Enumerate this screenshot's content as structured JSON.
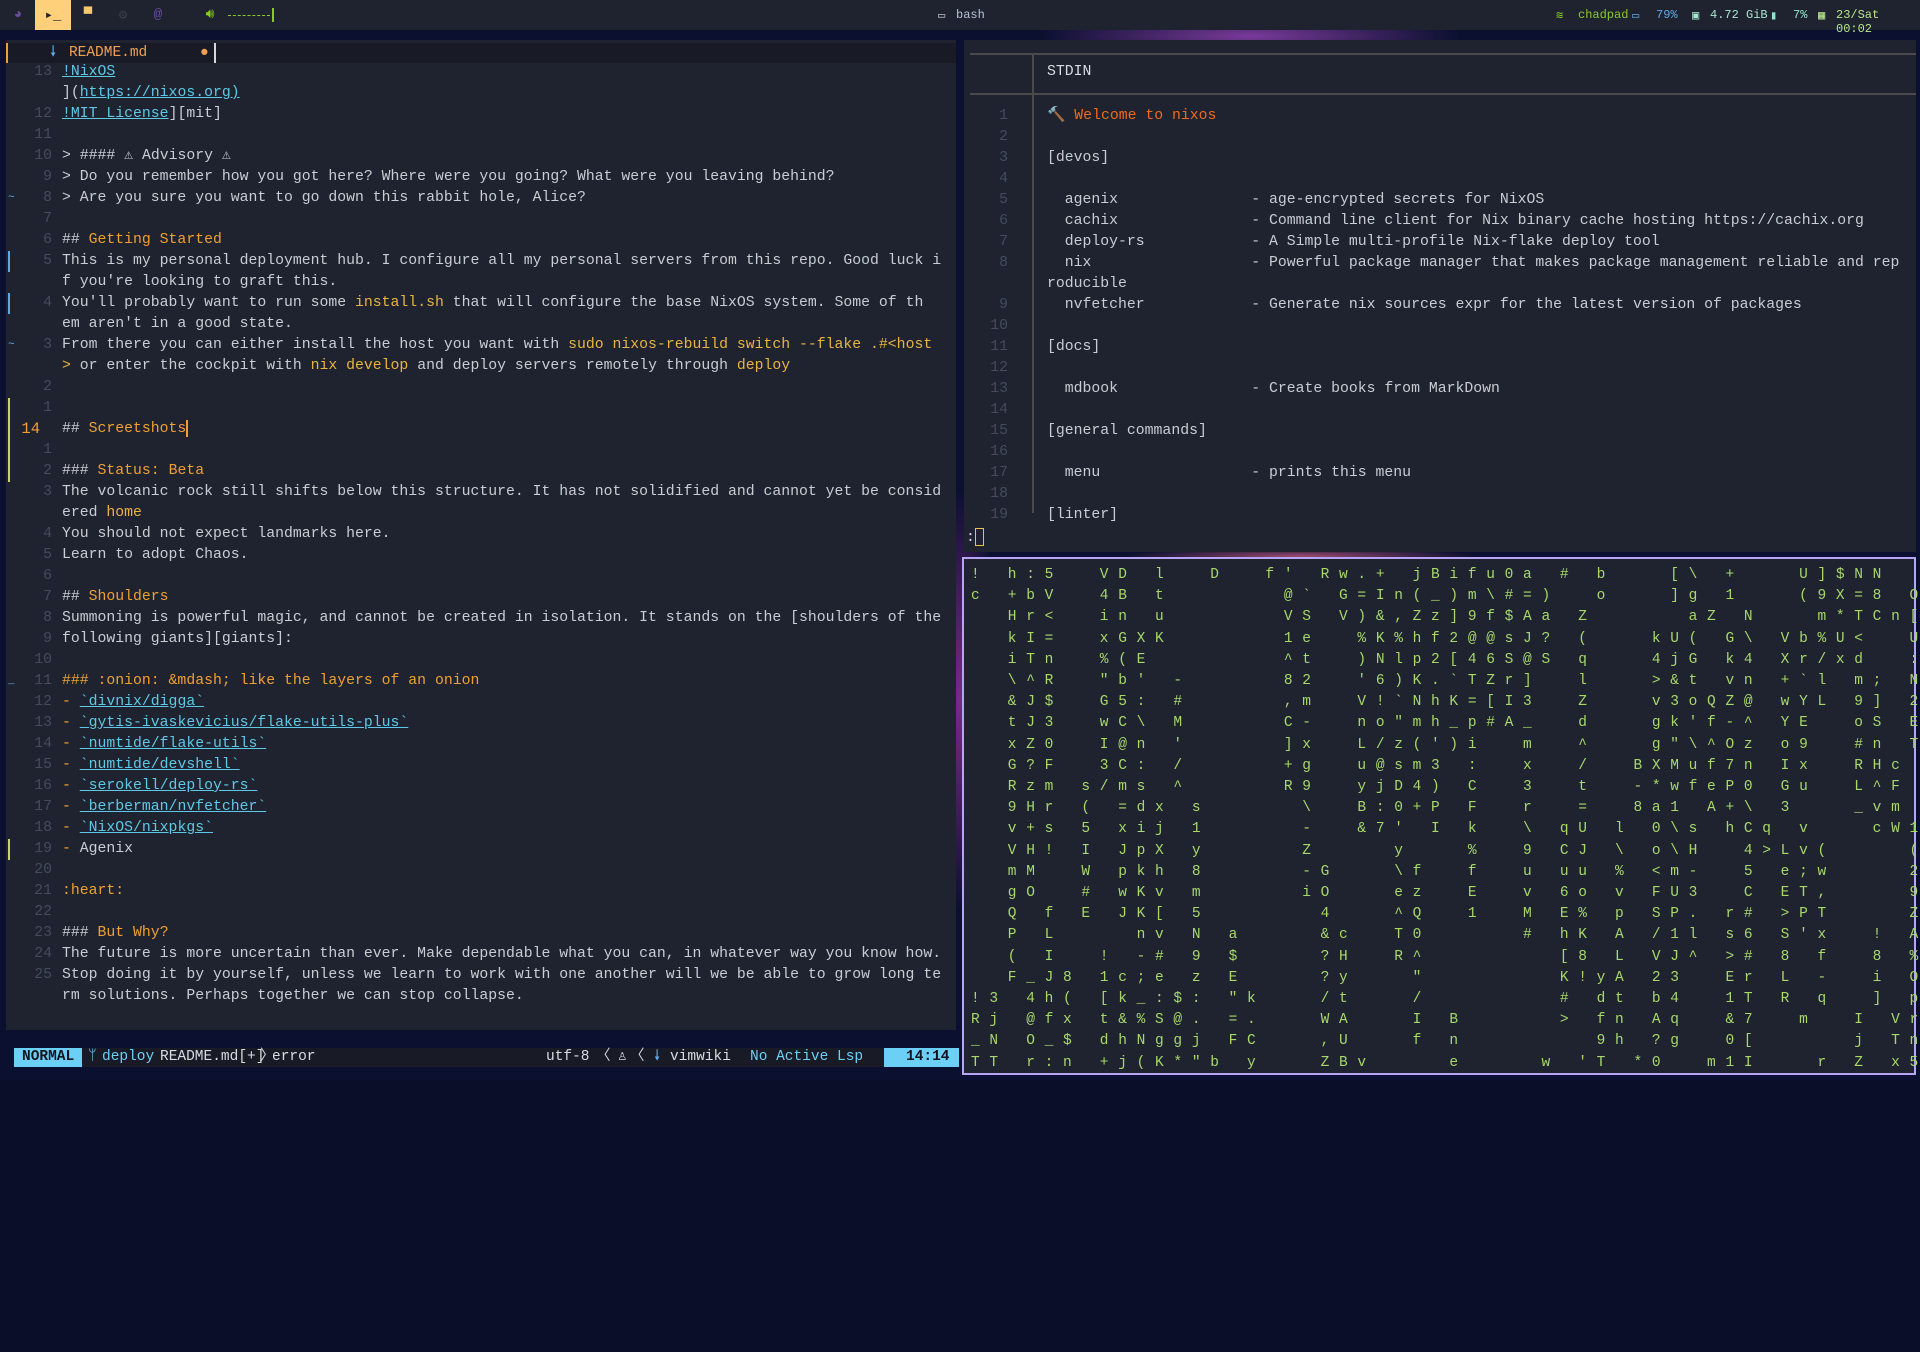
{
  "topbar": {
    "workspaces": [
      {
        "icon": "firefox-icon",
        "glyph": "◕",
        "color": "#6a4c9c"
      },
      {
        "icon": "terminal-icon",
        "glyph": "▸_",
        "color": "#1f2330",
        "active": true
      },
      {
        "icon": "chat-icon",
        "glyph": "▀",
        "color": "#f5c86a"
      },
      {
        "icon": "gear-icon",
        "glyph": "⚙",
        "color": "#3a3f4c"
      },
      {
        "icon": "at-icon",
        "glyph": "@",
        "color": "#6a4c9c"
      }
    ],
    "volume_level": 1.0,
    "window_title": "bash",
    "wifi": "chadpad",
    "battery": "79%",
    "memory": "4.72 GiB",
    "cpu": "7%",
    "datetime": "23/Sat 00:02",
    "colors": {
      "green": "#8ac926",
      "blue": "#5fa8e6",
      "active": "#ffd07a"
    }
  },
  "editor": {
    "tab": {
      "filename": "README.md",
      "modified": "●"
    },
    "lines": [
      {
        "n": "13",
        "s": [
          [
            "!NixOS",
            "link"
          ]
        ]
      },
      {
        "n": "",
        "s": [
          [
            "](",
            "t"
          ],
          [
            "https://nixos.org)",
            "link"
          ]
        ]
      },
      {
        "n": "12",
        "s": [
          [
            "!MIT License",
            "link"
          ],
          [
            "][mit]",
            "t"
          ]
        ]
      },
      {
        "n": "11",
        "s": []
      },
      {
        "n": "10",
        "s": [
          [
            "> #### ⚠ Advisory ⚠",
            "t"
          ]
        ]
      },
      {
        "n": "9",
        "s": [
          [
            "> Do you remember how you got here? Where were you going? What were you leaving behind?",
            "t"
          ]
        ]
      },
      {
        "n": "8",
        "sign": "~",
        "s": [
          [
            "> Are you sure you want to go down this rabbit hole, Alice?",
            "t"
          ]
        ]
      },
      {
        "n": "7",
        "s": []
      },
      {
        "n": "6",
        "s": [
          [
            "## ",
            "t"
          ],
          [
            "Getting Started",
            "h"
          ]
        ]
      },
      {
        "n": "5",
        "bar": "#5fa8e6",
        "s": [
          [
            "This is my personal deployment hub. I configure all my personal servers from this repo. Good luck i",
            "t"
          ]
        ]
      },
      {
        "n": "",
        "s": [
          [
            "f you're looking to graft this.",
            "t"
          ]
        ]
      },
      {
        "n": "4",
        "bar": "#5fa8e6",
        "s": [
          [
            "You'll probably want to run some ",
            "t"
          ],
          [
            "install.sh",
            "code"
          ],
          [
            " that will configure the base NixOS system. Some of th",
            "t"
          ]
        ]
      },
      {
        "n": "",
        "s": [
          [
            "em aren't in a good state.",
            "t"
          ]
        ]
      },
      {
        "n": "3",
        "sign": "~",
        "s": [
          [
            "From there you can either install the host you want with ",
            "t"
          ],
          [
            "sudo nixos-rebuild switch --flake .#<host",
            "code"
          ]
        ]
      },
      {
        "n": "",
        "s": [
          [
            "> ",
            "code"
          ],
          [
            "or enter the cockpit with ",
            "t"
          ],
          [
            "nix develop",
            "code"
          ],
          [
            " and deploy servers remotely through ",
            "t"
          ],
          [
            "deploy",
            "code"
          ]
        ]
      },
      {
        "n": "2",
        "s": []
      },
      {
        "n": "1",
        "bar": "#c8d46a",
        "s": []
      },
      {
        "n": "14",
        "cur": true,
        "bar": "#c8d46a",
        "s": [
          [
            "## ",
            "t"
          ],
          [
            "Screetshots",
            "h"
          ]
        ]
      },
      {
        "n": "1",
        "bar": "#c8d46a",
        "s": []
      },
      {
        "n": "2",
        "bar": "#c8d46a",
        "s": [
          [
            "### ",
            "t"
          ],
          [
            "Status: Beta",
            "h"
          ]
        ]
      },
      {
        "n": "3",
        "s": [
          [
            "The volcanic rock still shifts below this structure. It has not solidified and cannot yet be consid",
            "t"
          ]
        ]
      },
      {
        "n": "",
        "s": [
          [
            "ered ",
            "t"
          ],
          [
            "home",
            "code"
          ]
        ]
      },
      {
        "n": "4",
        "s": [
          [
            "You should not expect landmarks here.",
            "t"
          ]
        ]
      },
      {
        "n": "5",
        "s": [
          [
            "Learn to adopt Chaos.",
            "t"
          ]
        ]
      },
      {
        "n": "6",
        "s": []
      },
      {
        "n": "7",
        "s": [
          [
            "## ",
            "t"
          ],
          [
            "Shoulders",
            "h"
          ]
        ]
      },
      {
        "n": "8",
        "s": [
          [
            "Summoning is powerful magic, and cannot be created in isolation. It stands on the [shoulders of the",
            "t"
          ]
        ]
      },
      {
        "n": "9",
        "s": [
          [
            "following giants][giants]:",
            "t"
          ]
        ]
      },
      {
        "n": "10",
        "s": []
      },
      {
        "n": "11",
        "sign": "_",
        "s": [
          [
            "### :onion: &mdash; like the layers of an onion",
            "h"
          ]
        ]
      },
      {
        "n": "12",
        "s": [
          [
            "- ",
            "h"
          ],
          [
            "`divnix/digga`",
            "link"
          ]
        ]
      },
      {
        "n": "13",
        "s": [
          [
            "- ",
            "h"
          ],
          [
            "`gytis-ivaskevicius/flake-utils-plus`",
            "link"
          ]
        ]
      },
      {
        "n": "14",
        "s": [
          [
            "- ",
            "h"
          ],
          [
            "`numtide/flake-utils`",
            "link"
          ]
        ]
      },
      {
        "n": "15",
        "s": [
          [
            "- ",
            "h"
          ],
          [
            "`numtide/devshell`",
            "link"
          ]
        ]
      },
      {
        "n": "16",
        "s": [
          [
            "- ",
            "h"
          ],
          [
            "`serokell/deploy-rs`",
            "link"
          ]
        ]
      },
      {
        "n": "17",
        "s": [
          [
            "- ",
            "h"
          ],
          [
            "`berberman/nvfetcher`",
            "link"
          ]
        ]
      },
      {
        "n": "18",
        "s": [
          [
            "- ",
            "h"
          ],
          [
            "`NixOS/nixpkgs`",
            "link"
          ]
        ]
      },
      {
        "n": "19",
        "bar": "#c8d46a",
        "s": [
          [
            "- ",
            "h"
          ],
          [
            "Agenix",
            "t"
          ]
        ]
      },
      {
        "n": "20",
        "s": []
      },
      {
        "n": "21",
        "s": [
          [
            ":heart:",
            "h"
          ]
        ]
      },
      {
        "n": "22",
        "s": []
      },
      {
        "n": "23",
        "s": [
          [
            "### ",
            "t"
          ],
          [
            "But Why?",
            "h"
          ]
        ]
      },
      {
        "n": "24",
        "s": [
          [
            "The future is more uncertain than ever. Make dependable what you can, in whatever way you know how.",
            "t"
          ]
        ]
      },
      {
        "n": "25",
        "s": [
          [
            "Stop doing it by yourself, unless we learn to work with one another will we be able to grow long te",
            "t"
          ]
        ]
      },
      {
        "n": "",
        "s": [
          [
            "rm solutions. Perhaps together we can stop collapse.",
            "t"
          ]
        ]
      }
    ],
    "status": {
      "mode": "NORMAL",
      "branch_icon": "git-branch-icon",
      "branch": "deploy",
      "file": "README.md[+]",
      "diagnostic": "error",
      "encoding": "utf-8",
      "os_icon": "linux-icon",
      "filetype": "vimwiki",
      "lsp": "No Active Lsp",
      "position": "14:14"
    }
  },
  "pager": {
    "header": "STDIN",
    "lines": [
      {
        "n": "1",
        "text": "🔨 Welcome to nixos",
        "color": "#f06a1a"
      },
      {
        "n": "2",
        "text": ""
      },
      {
        "n": "3",
        "text": "[devos]"
      },
      {
        "n": "4",
        "text": ""
      },
      {
        "n": "5",
        "text": "  agenix               - age-encrypted secrets for NixOS"
      },
      {
        "n": "6",
        "text": "  cachix               - Command line client for Nix binary cache hosting https://cachix.org"
      },
      {
        "n": "7",
        "text": "  deploy-rs            - A Simple multi-profile Nix-flake deploy tool"
      },
      {
        "n": "8",
        "text": "  nix                  - Powerful package manager that makes package management reliable and rep"
      },
      {
        "n": "",
        "text": "roducible"
      },
      {
        "n": "9",
        "text": "  nvfetcher            - Generate nix sources expr for the latest version of packages"
      },
      {
        "n": "10",
        "text": ""
      },
      {
        "n": "11",
        "text": "[docs]"
      },
      {
        "n": "12",
        "text": ""
      },
      {
        "n": "13",
        "text": "  mdbook               - Create books from MarkDown"
      },
      {
        "n": "14",
        "text": ""
      },
      {
        "n": "15",
        "text": "[general commands]"
      },
      {
        "n": "16",
        "text": ""
      },
      {
        "n": "17",
        "text": "  menu                 - prints this menu"
      },
      {
        "n": "18",
        "text": ""
      },
      {
        "n": "19",
        "text": "[linter]"
      }
    ],
    "prompt": ":"
  },
  "matrix": {
    "color": "#a6d86a",
    "rows": [
      "! h:5  VD l  D  f' Rw.+ jBifu0a # b   [\\ +   U]$NN  ",
      "c +bV  4B t      @` G=In(_)m\\#=)  o   ]g 1   (9X=8 O",
      "  Hr<  in u      VS V)&,Zz]9f$Aa Z     aZ N   m*TCn[ =",
      "  kI=  xGXK      1e  %K%hf2@@sJ? (   kU( G\\ Vb%U<  U",
      "  iTn  %(E       ^t  )Nlp2[46S@S q   4jG k4 Xr/xd  :",
      "  \\^R  \"b' -     82  '6)K.`TZr]  l   >&t vn +`l m; N",
      "  &J$  G5: #     ,m  V!`NhK=[I3  Z   v3oQZ@ wYL 9] 2",
      "  tJ3  wC\\ M     C-  no\"mh_p#A_  d   gk'f-^ YE  oS E",
      "  xZ0  I@n '     ]x  L/z(')i  m  ^   g\"\\^Oz o9  #n T",
      "  G?F  3C: /     +g  u@sm3 :  x  /  BXMuf7n Ix  RHc",
      "  Rzm s/ms ^     R9  yjD4) C  3  t  -*wfeP0 Gu  L^F",
      "  9Hr ( =dx s     \\  B:0+P F  r  =  8a1 A+\\ 3   _vm",
      "  v+s 5 xij 1     -  &7' I k  \\ qU l 0\\s hCq v   cW1",
      "  VH! I JpX y     Z    y   %  9 CJ \\ o\\H  4>Lv(    (",
      "  mM  W pkh 8     -G   \\f  f  u uu % <m-  5 e;w    2",
      "  gO  # wKv m     iO   ez  E  v 6o v FU3  C ET,    9",
      "  Q f E JK[ 5      4   ^Q  1  M E% p SP. r# >PT    Z",
      "  P L    nv N a    &c  T0     # hK A /1l s6 S'x  ! A",
      "  ( I  ! -# 9 $    ?H  R^       [8 L VJ^ ># 8 f  8 %P",
      "  F_J8 1c;e z E    ?y   \"       K!yA 23  Er L -  i OH",
      "!3 4h( [k_:$: \"k   /t   /       # dt b4  1T R q  ] pX",
      "Rj @fx t&%S@. =.   WA   I B     > fn Aq  &7  m  I Vr",
      "_N O_$ dhNggj FC   ,U   f n       9h ?g  0[     j Tn",
      "TT r:n +j(K*\"b y   ZBv    e    w 'T *0  m1I   r Z x5"
    ]
  }
}
